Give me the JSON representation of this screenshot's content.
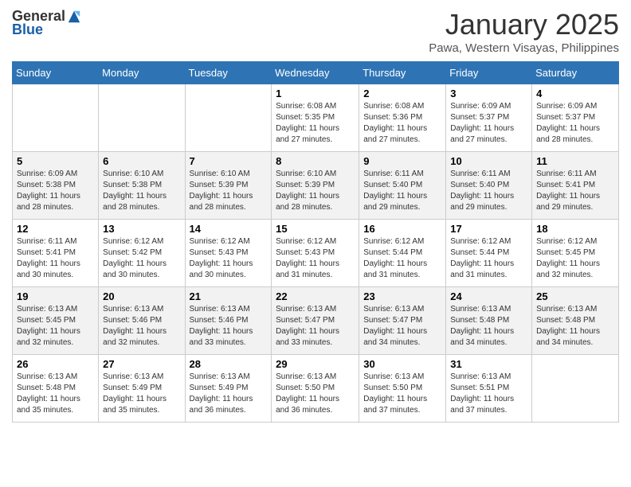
{
  "header": {
    "logo_general": "General",
    "logo_blue": "Blue",
    "month_title": "January 2025",
    "subtitle": "Pawa, Western Visayas, Philippines"
  },
  "days_of_week": [
    "Sunday",
    "Monday",
    "Tuesday",
    "Wednesday",
    "Thursday",
    "Friday",
    "Saturday"
  ],
  "weeks": [
    [
      {
        "day": "",
        "info": ""
      },
      {
        "day": "",
        "info": ""
      },
      {
        "day": "",
        "info": ""
      },
      {
        "day": "1",
        "info": "Sunrise: 6:08 AM\nSunset: 5:35 PM\nDaylight: 11 hours and 27 minutes."
      },
      {
        "day": "2",
        "info": "Sunrise: 6:08 AM\nSunset: 5:36 PM\nDaylight: 11 hours and 27 minutes."
      },
      {
        "day": "3",
        "info": "Sunrise: 6:09 AM\nSunset: 5:37 PM\nDaylight: 11 hours and 27 minutes."
      },
      {
        "day": "4",
        "info": "Sunrise: 6:09 AM\nSunset: 5:37 PM\nDaylight: 11 hours and 28 minutes."
      }
    ],
    [
      {
        "day": "5",
        "info": "Sunrise: 6:09 AM\nSunset: 5:38 PM\nDaylight: 11 hours and 28 minutes."
      },
      {
        "day": "6",
        "info": "Sunrise: 6:10 AM\nSunset: 5:38 PM\nDaylight: 11 hours and 28 minutes."
      },
      {
        "day": "7",
        "info": "Sunrise: 6:10 AM\nSunset: 5:39 PM\nDaylight: 11 hours and 28 minutes."
      },
      {
        "day": "8",
        "info": "Sunrise: 6:10 AM\nSunset: 5:39 PM\nDaylight: 11 hours and 28 minutes."
      },
      {
        "day": "9",
        "info": "Sunrise: 6:11 AM\nSunset: 5:40 PM\nDaylight: 11 hours and 29 minutes."
      },
      {
        "day": "10",
        "info": "Sunrise: 6:11 AM\nSunset: 5:40 PM\nDaylight: 11 hours and 29 minutes."
      },
      {
        "day": "11",
        "info": "Sunrise: 6:11 AM\nSunset: 5:41 PM\nDaylight: 11 hours and 29 minutes."
      }
    ],
    [
      {
        "day": "12",
        "info": "Sunrise: 6:11 AM\nSunset: 5:41 PM\nDaylight: 11 hours and 30 minutes."
      },
      {
        "day": "13",
        "info": "Sunrise: 6:12 AM\nSunset: 5:42 PM\nDaylight: 11 hours and 30 minutes."
      },
      {
        "day": "14",
        "info": "Sunrise: 6:12 AM\nSunset: 5:43 PM\nDaylight: 11 hours and 30 minutes."
      },
      {
        "day": "15",
        "info": "Sunrise: 6:12 AM\nSunset: 5:43 PM\nDaylight: 11 hours and 31 minutes."
      },
      {
        "day": "16",
        "info": "Sunrise: 6:12 AM\nSunset: 5:44 PM\nDaylight: 11 hours and 31 minutes."
      },
      {
        "day": "17",
        "info": "Sunrise: 6:12 AM\nSunset: 5:44 PM\nDaylight: 11 hours and 31 minutes."
      },
      {
        "day": "18",
        "info": "Sunrise: 6:12 AM\nSunset: 5:45 PM\nDaylight: 11 hours and 32 minutes."
      }
    ],
    [
      {
        "day": "19",
        "info": "Sunrise: 6:13 AM\nSunset: 5:45 PM\nDaylight: 11 hours and 32 minutes."
      },
      {
        "day": "20",
        "info": "Sunrise: 6:13 AM\nSunset: 5:46 PM\nDaylight: 11 hours and 32 minutes."
      },
      {
        "day": "21",
        "info": "Sunrise: 6:13 AM\nSunset: 5:46 PM\nDaylight: 11 hours and 33 minutes."
      },
      {
        "day": "22",
        "info": "Sunrise: 6:13 AM\nSunset: 5:47 PM\nDaylight: 11 hours and 33 minutes."
      },
      {
        "day": "23",
        "info": "Sunrise: 6:13 AM\nSunset: 5:47 PM\nDaylight: 11 hours and 34 minutes."
      },
      {
        "day": "24",
        "info": "Sunrise: 6:13 AM\nSunset: 5:48 PM\nDaylight: 11 hours and 34 minutes."
      },
      {
        "day": "25",
        "info": "Sunrise: 6:13 AM\nSunset: 5:48 PM\nDaylight: 11 hours and 34 minutes."
      }
    ],
    [
      {
        "day": "26",
        "info": "Sunrise: 6:13 AM\nSunset: 5:48 PM\nDaylight: 11 hours and 35 minutes."
      },
      {
        "day": "27",
        "info": "Sunrise: 6:13 AM\nSunset: 5:49 PM\nDaylight: 11 hours and 35 minutes."
      },
      {
        "day": "28",
        "info": "Sunrise: 6:13 AM\nSunset: 5:49 PM\nDaylight: 11 hours and 36 minutes."
      },
      {
        "day": "29",
        "info": "Sunrise: 6:13 AM\nSunset: 5:50 PM\nDaylight: 11 hours and 36 minutes."
      },
      {
        "day": "30",
        "info": "Sunrise: 6:13 AM\nSunset: 5:50 PM\nDaylight: 11 hours and 37 minutes."
      },
      {
        "day": "31",
        "info": "Sunrise: 6:13 AM\nSunset: 5:51 PM\nDaylight: 11 hours and 37 minutes."
      },
      {
        "day": "",
        "info": ""
      }
    ]
  ]
}
